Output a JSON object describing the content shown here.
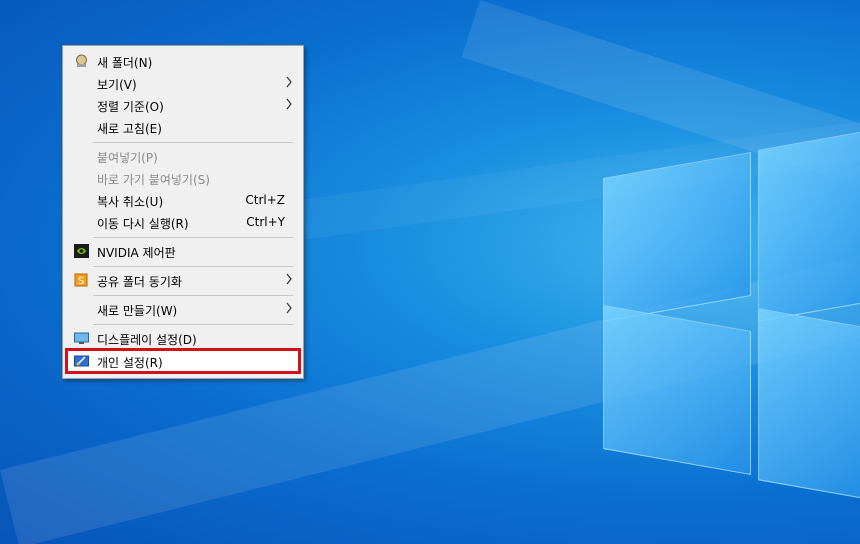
{
  "menu": {
    "items": [
      {
        "label": "새 폴더(N)",
        "icon": "folder-gear-icon",
        "enabled": true
      },
      {
        "label": "보기(V)",
        "submenu": true,
        "enabled": true
      },
      {
        "label": "정렬 기준(O)",
        "submenu": true,
        "enabled": true
      },
      {
        "label": "새로 고침(E)",
        "enabled": true
      },
      {
        "label": "붙여넣기(P)",
        "enabled": false
      },
      {
        "label": "바로 가기 붙여넣기(S)",
        "enabled": false
      },
      {
        "label": "복사 취소(U)",
        "shortcut": "Ctrl+Z",
        "enabled": true
      },
      {
        "label": "이동 다시 실행(R)",
        "shortcut": "Ctrl+Y",
        "enabled": true
      },
      {
        "label": "NVIDIA 제어판",
        "icon": "nvidia-icon",
        "enabled": true
      },
      {
        "label": "공유 폴더 동기화",
        "icon": "sync-icon",
        "submenu": true,
        "enabled": true
      },
      {
        "label": "새로 만들기(W)",
        "submenu": true,
        "enabled": true
      },
      {
        "label": "디스플레이 설정(D)",
        "icon": "display-icon",
        "enabled": true
      },
      {
        "label": "개인 설정(R)",
        "icon": "personalize-icon",
        "enabled": true,
        "highlighted": true
      }
    ],
    "highlight_color": "#d0101a"
  },
  "arrow_glyph": "›"
}
